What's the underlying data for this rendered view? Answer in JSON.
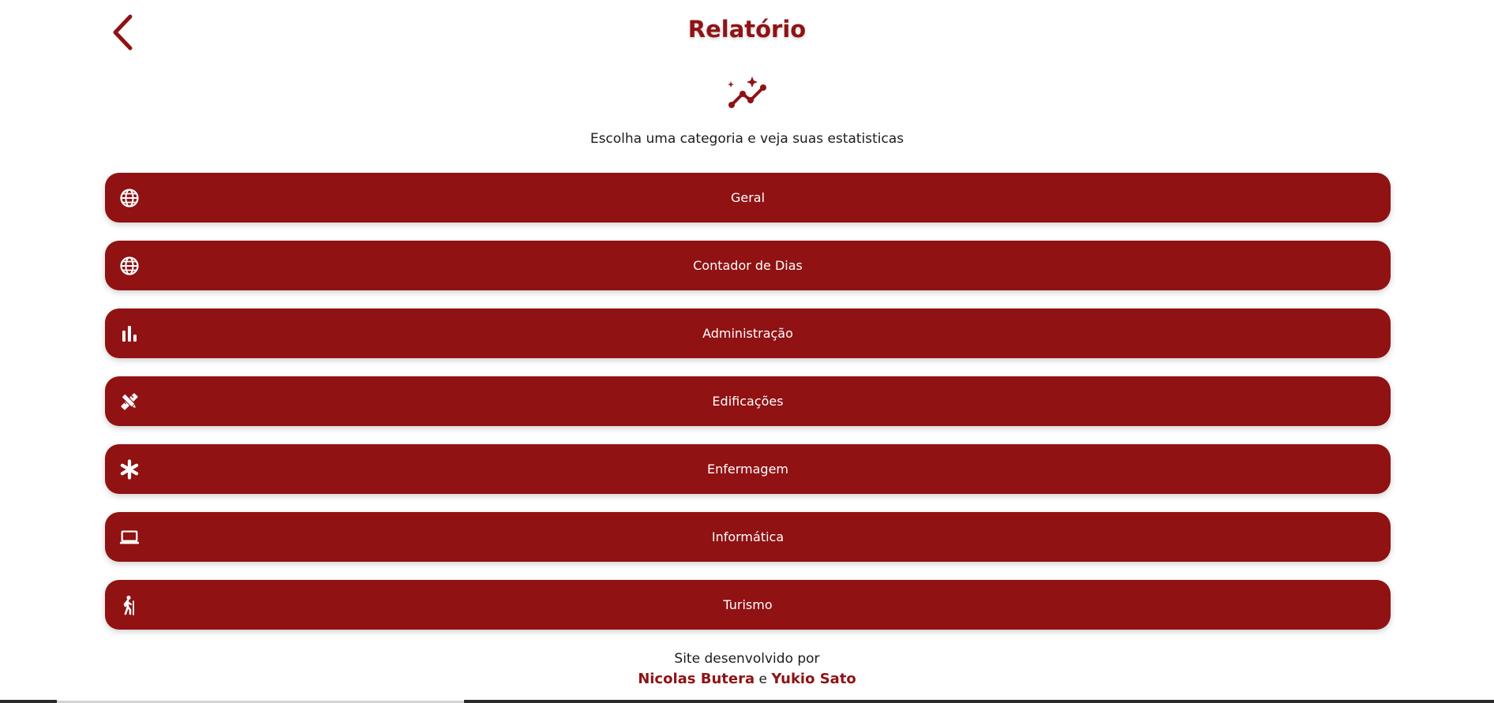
{
  "header": {
    "title": "Relatório",
    "back_icon": "chevron-left-icon"
  },
  "hero": {
    "icon": "sparkle-chart-icon",
    "subtitle": "Escolha uma categoria e veja suas estatisticas"
  },
  "categories": [
    {
      "label": "Geral",
      "icon": "globe-icon"
    },
    {
      "label": "Contador de Dias",
      "icon": "globe-icon"
    },
    {
      "label": "Administração",
      "icon": "bar-chart-icon"
    },
    {
      "label": "Edificações",
      "icon": "ruler-pencil-icon"
    },
    {
      "label": "Enfermagem",
      "icon": "asterisk-icon"
    },
    {
      "label": "Informática",
      "icon": "laptop-icon"
    },
    {
      "label": "Turismo",
      "icon": "hiking-icon"
    }
  ],
  "footer": {
    "line1": "Site desenvolvido por",
    "author1": "Nicolas Butera",
    "connector": "e",
    "author2": "Yukio Sato"
  },
  "colors": {
    "primary": "#901213",
    "title": "#8f1315",
    "text": "#1c1c1c",
    "background": "#ffffff"
  }
}
